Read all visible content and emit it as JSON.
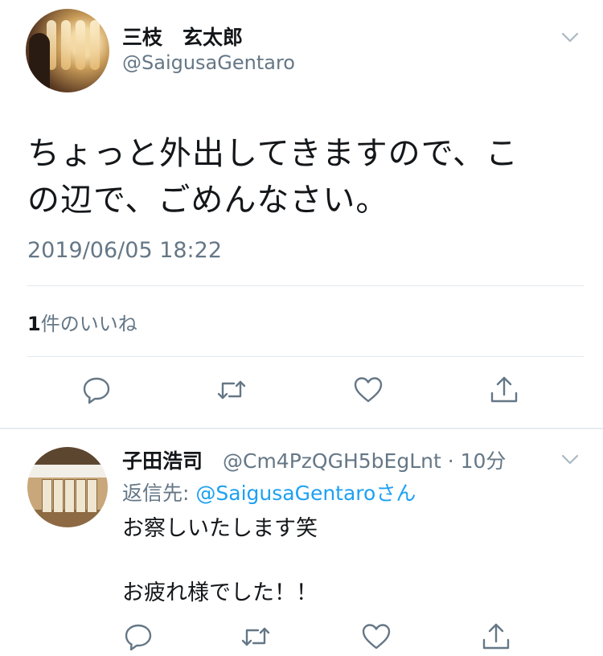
{
  "tweet": {
    "display_name": "三枝　玄太郎",
    "handle": "@SaigusaGentaro",
    "text_line1": "ちょっと外出してきますので、こ",
    "text_line2": "の辺で、ごめんなさい。",
    "timestamp": "2019/06/05 18:22",
    "like_count": "1",
    "like_label": "件のいいね",
    "icons": [
      "chevron-down-icon",
      "reply-icon",
      "retweet-icon",
      "like-icon",
      "share-icon"
    ]
  },
  "reply": {
    "display_name": "子田浩司",
    "handle_meta": "@Cm4PzQGH5bEgLnt · 10分",
    "replying_prefix": "返信先: ",
    "replying_handle": "@SaigusaGentaro",
    "replying_suffix": "さん",
    "text": "お察しいたします笑\n\nお疲れ様でした！！"
  },
  "colors": {
    "accent": "#1da1f2",
    "muted": "#657786",
    "text": "#14171a",
    "divider": "#e1e8ed"
  }
}
